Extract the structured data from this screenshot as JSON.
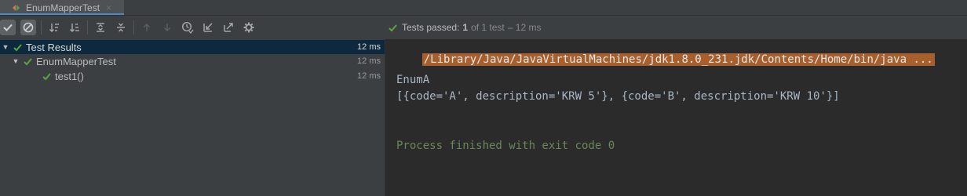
{
  "run_tab": {
    "title": "EnumMapperTest",
    "close": "×"
  },
  "status": {
    "prefix": "Tests passed:",
    "count": "1",
    "of_tests": "of 1 test",
    "duration": "– 12 ms"
  },
  "tree": {
    "items": [
      {
        "label": "Test Results",
        "time": "12 ms",
        "arrow": "▼"
      },
      {
        "label": "EnumMapperTest",
        "time": "12 ms",
        "arrow": "▼"
      },
      {
        "label": "test1()",
        "time": "12 ms",
        "arrow": ""
      }
    ]
  },
  "console": {
    "command": "/Library/Java/JavaVirtualMachines/jdk1.8.0_231.jdk/Contents/Home/bin/java ...",
    "output": [
      "EnumA",
      "[{code='A', description='KRW 5'}, {code='B', description='KRW 10'}]"
    ],
    "exit": "Process finished with exit code 0"
  },
  "colors": {
    "pass_green": "#5aa33f",
    "command_bg": "#a85f2e",
    "exit_green": "#6a8759",
    "selection": "#0d293e"
  },
  "icons": {
    "toolbar": [
      "show-passed-icon",
      "show-ignored-icon",
      "sort-alpha-icon",
      "sort-duration-icon",
      "expand-all-icon",
      "collapse-all-icon",
      "previous-test-icon",
      "next-test-icon",
      "test-history-icon",
      "import-tests-icon",
      "export-tests-icon",
      "settings-gear-icon"
    ]
  }
}
